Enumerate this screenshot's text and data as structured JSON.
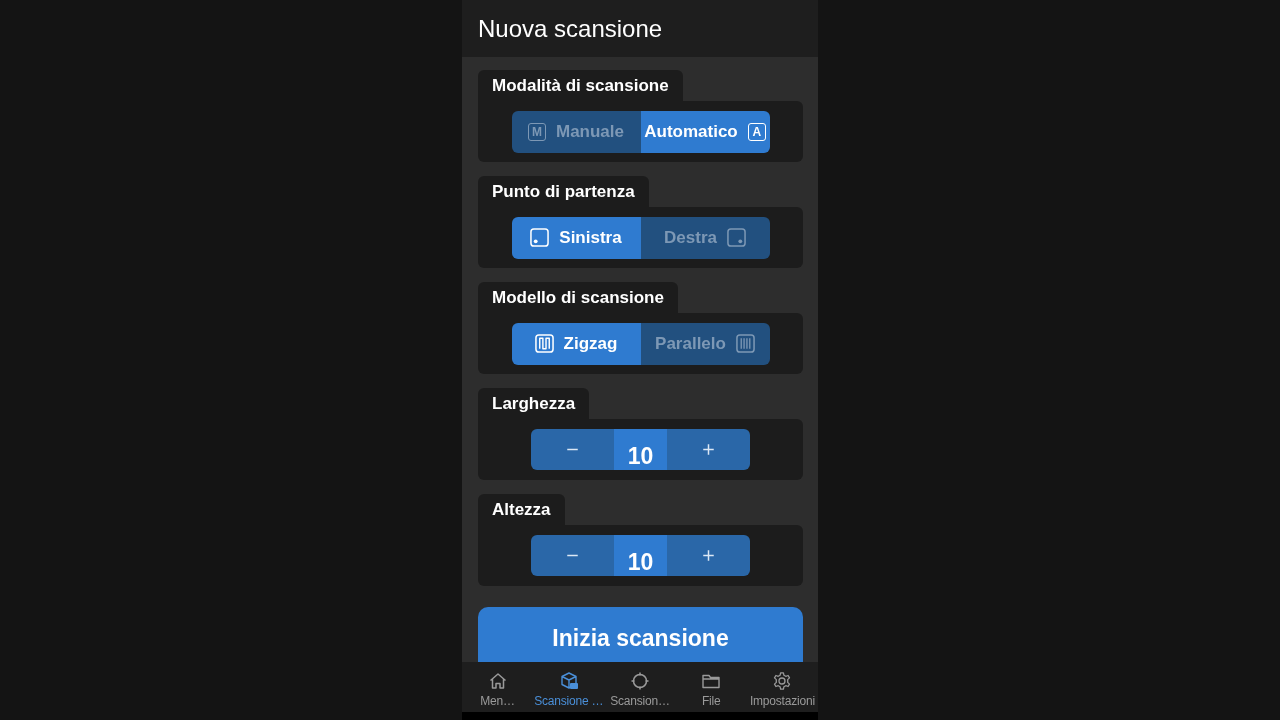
{
  "screen": {
    "title": "Nuova scansione"
  },
  "sections": [
    {
      "kind": "segmented",
      "label": "Modalità di scansione",
      "options": [
        {
          "label": "Manuale",
          "badge": "M",
          "selected": false
        },
        {
          "label": "Automatico",
          "badge": "A",
          "selected": true
        }
      ]
    },
    {
      "kind": "segmented",
      "label": "Punto di partenza",
      "options": [
        {
          "label": "Sinistra",
          "selected": true
        },
        {
          "label": "Destra",
          "selected": false
        }
      ]
    },
    {
      "kind": "segmented",
      "label": "Modello di scansione",
      "options": [
        {
          "label": "Zigzag",
          "selected": true
        },
        {
          "label": "Parallelo",
          "selected": false
        }
      ]
    },
    {
      "kind": "stepper",
      "label": "Larghezza",
      "value": "10"
    },
    {
      "kind": "stepper",
      "label": "Altezza",
      "value": "10"
    }
  ],
  "start_button": {
    "label": "Inizia scansione"
  },
  "bottom_nav": [
    {
      "label": "Men…",
      "selected": false
    },
    {
      "label": "Scansione …",
      "selected": true
    },
    {
      "label": "Scansion…",
      "selected": false
    },
    {
      "label": "File",
      "selected": false
    },
    {
      "label": "Impostazioni",
      "selected": false
    }
  ]
}
